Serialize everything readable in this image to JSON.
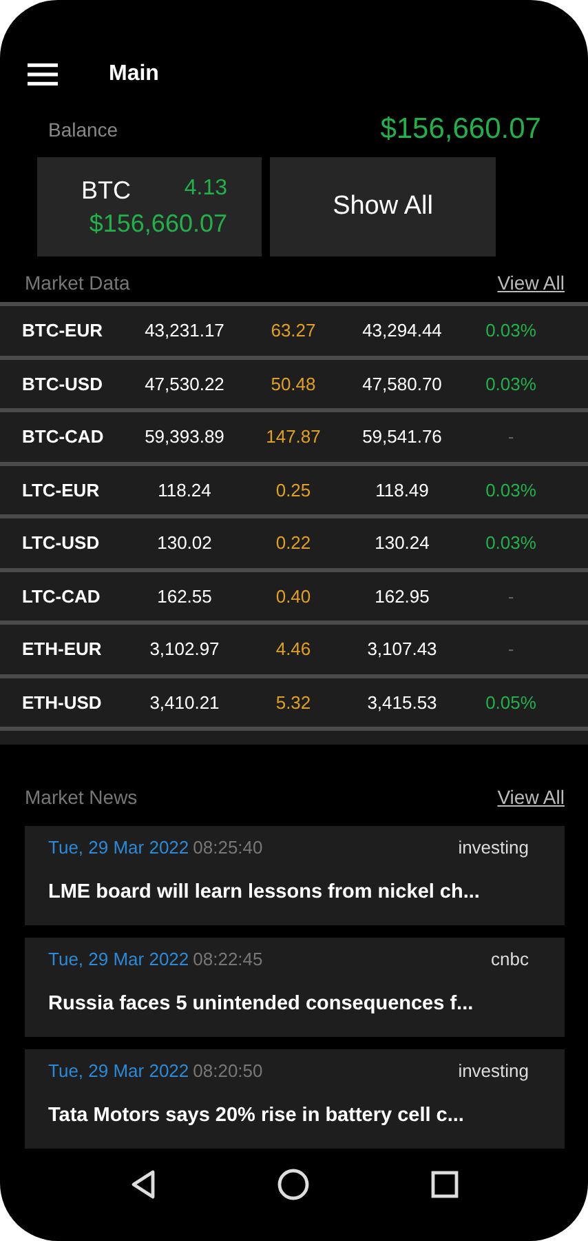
{
  "header": {
    "title": "Main"
  },
  "balance": {
    "label": "Balance",
    "value": "$156,660.07"
  },
  "wallet_card": {
    "coin": "BTC",
    "amount": "4.13",
    "value": "$156,660.07"
  },
  "show_all_button": "Show All",
  "market_data": {
    "title": "Market Data",
    "link": "View All",
    "rows": [
      {
        "pair": "BTC-EUR",
        "bid": "43,231.17",
        "change": "63.27",
        "ask": "43,294.44",
        "percent": "0.03%",
        "positive": true
      },
      {
        "pair": "BTC-USD",
        "bid": "47,530.22",
        "change": "50.48",
        "ask": "47,580.70",
        "percent": "0.03%",
        "positive": true
      },
      {
        "pair": "BTC-CAD",
        "bid": "59,393.89",
        "change": "147.87",
        "ask": "59,541.76",
        "percent": "-",
        "positive": false
      },
      {
        "pair": "LTC-EUR",
        "bid": "118.24",
        "change": "0.25",
        "ask": "118.49",
        "percent": "0.03%",
        "positive": true
      },
      {
        "pair": "LTC-USD",
        "bid": "130.02",
        "change": "0.22",
        "ask": "130.24",
        "percent": "0.03%",
        "positive": true
      },
      {
        "pair": "LTC-CAD",
        "bid": "162.55",
        "change": "0.40",
        "ask": "162.95",
        "percent": "-",
        "positive": false
      },
      {
        "pair": "ETH-EUR",
        "bid": "3,102.97",
        "change": "4.46",
        "ask": "3,107.43",
        "percent": "-",
        "positive": false
      },
      {
        "pair": "ETH-USD",
        "bid": "3,410.21",
        "change": "5.32",
        "ask": "3,415.53",
        "percent": "0.05%",
        "positive": true
      }
    ]
  },
  "market_news": {
    "title": "Market News",
    "link": "View All",
    "items": [
      {
        "date": "Tue, 29 Mar 2022",
        "time": "08:25:40",
        "source": "investing",
        "headline": "LME board will learn lessons from nickel ch..."
      },
      {
        "date": "Tue, 29 Mar 2022",
        "time": "08:22:45",
        "source": "cnbc",
        "headline": "Russia faces 5 unintended consequences f..."
      },
      {
        "date": "Tue, 29 Mar 2022",
        "time": "08:20:50",
        "source": "investing",
        "headline": "Tata Motors says 20% rise in battery cell c..."
      }
    ]
  }
}
